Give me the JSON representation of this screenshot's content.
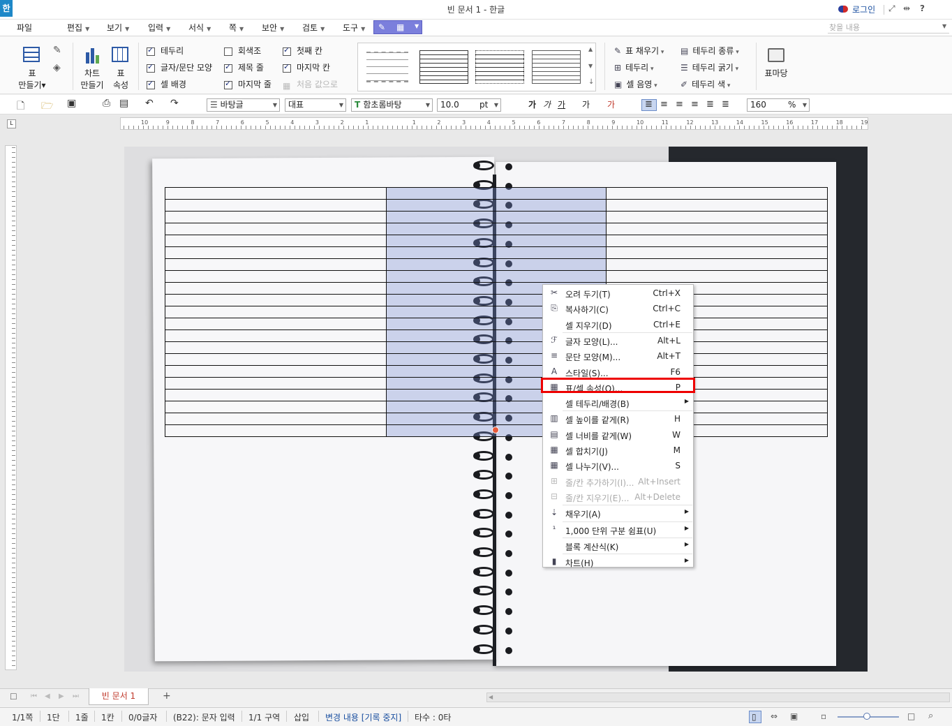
{
  "window": {
    "app_logo": "한",
    "title": "빈 문서 1 - 한글",
    "login": "로그인",
    "icons": [
      "fullscreen-icon",
      "pin-icon",
      "help-icon"
    ],
    "help": "?"
  },
  "menubar": {
    "file": "파일",
    "items": [
      "편집",
      "보기",
      "입력",
      "서식",
      "쪽",
      "보안",
      "검토",
      "도구"
    ],
    "find_placeholder": "찾을 내용"
  },
  "ribbon": {
    "table_make": [
      "표",
      "만들기▾"
    ],
    "chart_make": [
      "차트",
      "만들기"
    ],
    "table_props": [
      "표",
      "속성"
    ],
    "checks_col1": [
      {
        "label": "테두리",
        "checked": true
      },
      {
        "label": "글자/문단 모양",
        "checked": true
      },
      {
        "label": "셀 배경",
        "checked": true
      }
    ],
    "checks_col2": [
      {
        "label": "회색조",
        "checked": false
      },
      {
        "label": "제목 줄",
        "checked": true
      },
      {
        "label": "마지막 줄",
        "checked": true
      }
    ],
    "checks_col3": [
      {
        "label": "첫째 칸",
        "checked": true
      },
      {
        "label": "마지막 칸",
        "checked": true
      },
      {
        "label": "처음 값으로",
        "checked": false,
        "disabled": true
      }
    ],
    "right_col1": [
      "표 채우기",
      "테두리",
      "셀 음영"
    ],
    "right_col2": [
      "테두리 종류",
      "테두리 굵기",
      "테두리 색"
    ],
    "table_wizard": "표마당"
  },
  "toolbar": {
    "style": "바탕글",
    "lang": "대표",
    "font": "함초롬바탕",
    "size": "10.0",
    "unit": "pt",
    "char_btns": [
      "가",
      "가",
      "가"
    ],
    "zoom": "160",
    "zoom_unit": "%"
  },
  "ruler": {
    "h_left": [
      "10",
      "9",
      "8",
      "7",
      "6",
      "5",
      "4",
      "3",
      "2",
      "1"
    ],
    "h_right": [
      "1",
      "2",
      "3",
      "4",
      "5",
      "6",
      "7",
      "8",
      "9",
      "10",
      "11",
      "12",
      "13",
      "14",
      "15",
      "16",
      "17",
      "18",
      "19"
    ]
  },
  "context_menu": [
    {
      "icon": "✂",
      "label": "오려 두기(T)",
      "shortcut": "Ctrl+X"
    },
    {
      "icon": "⎘",
      "label": "복사하기(C)",
      "shortcut": "Ctrl+C"
    },
    {
      "icon": "",
      "label": "셀 지우기(D)",
      "shortcut": "Ctrl+E"
    },
    {
      "sep": true
    },
    {
      "icon": "ℱ",
      "label": "글자 모양(L)...",
      "shortcut": "Alt+L"
    },
    {
      "icon": "≡",
      "label": "문단 모양(M)...",
      "shortcut": "Alt+T"
    },
    {
      "icon": "A",
      "label": "스타일(S)...",
      "shortcut": "F6"
    },
    {
      "icon": "▦",
      "label": "표/셀 속성(Q)...",
      "shortcut": "P",
      "highlight": true
    },
    {
      "icon": "",
      "label": "셀 테두리/배경(B)",
      "shortcut": "",
      "submenu": true
    },
    {
      "sep": true
    },
    {
      "icon": "▥",
      "label": "셀 높이를 같게(R)",
      "shortcut": "H"
    },
    {
      "icon": "▤",
      "label": "셀 너비를 같게(W)",
      "shortcut": "W"
    },
    {
      "icon": "▦",
      "label": "셀 합치기(J)",
      "shortcut": "M"
    },
    {
      "icon": "▦",
      "label": "셀 나누기(V)...",
      "shortcut": "S"
    },
    {
      "icon": "⊞",
      "label": "줄/칸 추가하기(I)...",
      "shortcut": "Alt+Insert",
      "disabled": true
    },
    {
      "icon": "⊟",
      "label": "줄/칸 지우기(E)...",
      "shortcut": "Alt+Delete",
      "disabled": true
    },
    {
      "sep": true
    },
    {
      "icon": "⇣",
      "label": "채우기(A)",
      "shortcut": "",
      "submenu": true
    },
    {
      "sep": true
    },
    {
      "icon": "¹",
      "label": "1,000 단위 구분 쉼표(U)",
      "shortcut": "",
      "submenu": true
    },
    {
      "sep": true
    },
    {
      "icon": "",
      "label": "블록 계산식(K)",
      "shortcut": "",
      "submenu": true
    },
    {
      "sep": true
    },
    {
      "icon": "▮",
      "label": "차트(H)",
      "shortcut": "",
      "submenu": true
    }
  ],
  "tabs": {
    "doc_tab": "빈 문서 1",
    "add": "+"
  },
  "status": {
    "page": "1/1쪽",
    "col_stage": "1단",
    "line": "1줄",
    "col": "1칸",
    "chars": "0/0글자",
    "cell": "(B22): 문자 입력",
    "section": "1/1 구역",
    "mode": "삽입",
    "track": "변경 내용 [기록 중지]",
    "keys": "타수 : 0타"
  }
}
